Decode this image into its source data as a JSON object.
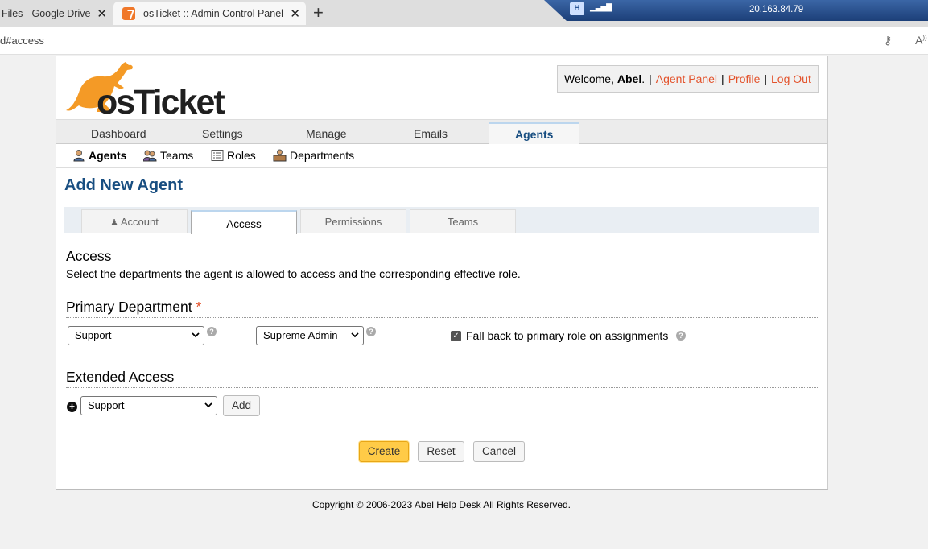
{
  "browser": {
    "tabs": [
      {
        "label": "Files - Google Drive",
        "active": false
      },
      {
        "label": "osTicket :: Admin Control Panel",
        "active": true
      }
    ],
    "url": "d#access",
    "vpn_ip": "20.163.84.79"
  },
  "header": {
    "logo_text": "osTicket",
    "welcome_prefix": "Welcome, ",
    "user_name": "Abel",
    "welcome_suffix": ".",
    "links": {
      "agent_panel": "Agent Panel",
      "profile": "Profile",
      "logout": "Log Out"
    },
    "link_color": "#e3522b"
  },
  "nav": {
    "items": [
      "Dashboard",
      "Settings",
      "Manage",
      "Emails",
      "Agents"
    ],
    "active": "Agents"
  },
  "subnav": {
    "items": [
      {
        "label": "Agents",
        "icon": "agent-icon",
        "active": true
      },
      {
        "label": "Teams",
        "icon": "team-icon",
        "active": false
      },
      {
        "label": "Roles",
        "icon": "roles-icon",
        "active": false
      },
      {
        "label": "Departments",
        "icon": "department-icon",
        "active": false
      }
    ]
  },
  "page": {
    "title": "Add New Agent",
    "title_color": "#184e81",
    "tabs": [
      {
        "label": "Account",
        "icon": "user-icon",
        "active": false
      },
      {
        "label": "Access",
        "active": true
      },
      {
        "label": "Permissions",
        "active": false
      },
      {
        "label": "Teams",
        "active": false
      }
    ]
  },
  "access": {
    "title": "Access",
    "description": "Select the departments the agent is allowed to access and the corresponding effective role.",
    "primary_department": {
      "title": "Primary Department",
      "required_mark": "*",
      "department_value": "Support",
      "role_value": "Supreme Admin",
      "fallback_label": "Fall back to primary role on assignments",
      "fallback_checked": true
    },
    "extended_access": {
      "title": "Extended Access",
      "department_value": "Support",
      "add_label": "Add"
    }
  },
  "actions": {
    "create": "Create",
    "reset": "Reset",
    "cancel": "Cancel",
    "primary_color": "#ffcb47"
  },
  "footer": {
    "copyright": "Copyright © 2006-2023 Abel Help Desk All Rights Reserved."
  }
}
